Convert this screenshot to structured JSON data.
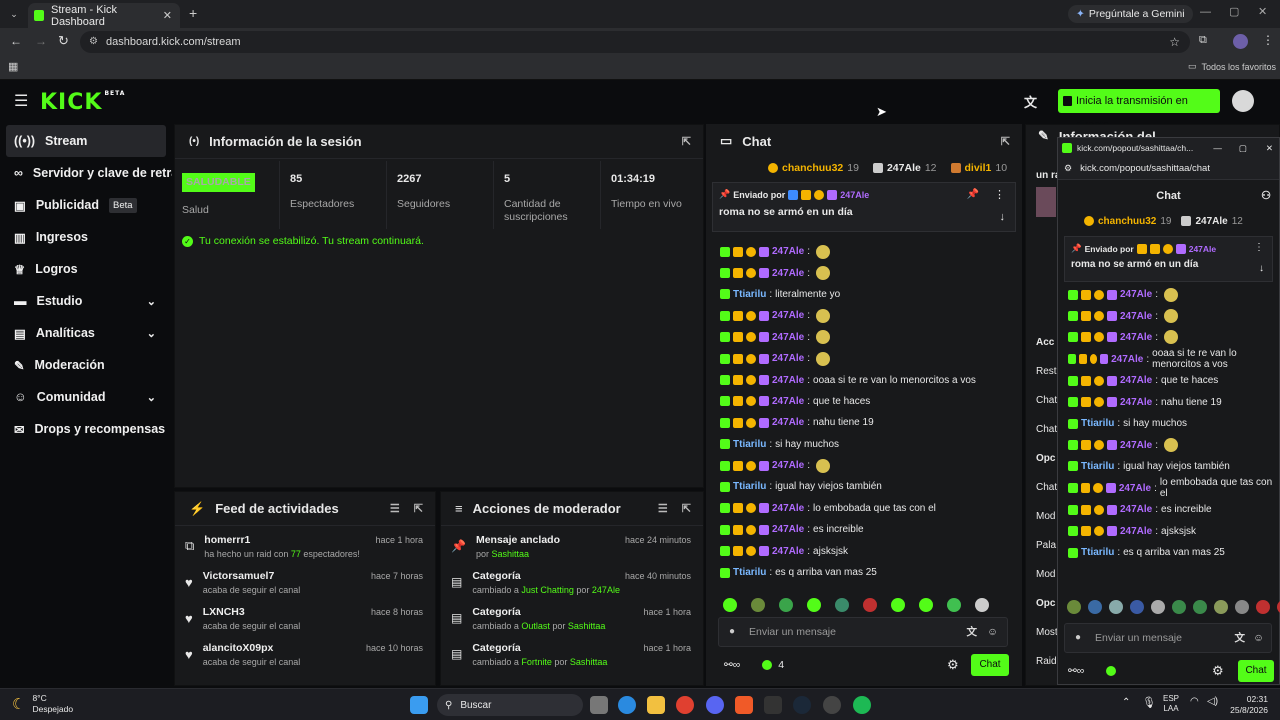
{
  "browser": {
    "tab_title": "Stream - Kick Dashboard",
    "url": "dashboard.kick.com/stream",
    "gemini_label": "Pregúntale a Gemini",
    "favorites_label": "Todos los favoritos"
  },
  "header": {
    "logo": "KICK",
    "logo_tag": "BETA",
    "go_live_label": "Inicia la transmisión en directo"
  },
  "sidebar": {
    "items": [
      {
        "label": "Stream",
        "icon": "broadcast-icon"
      },
      {
        "label": "Servidor y clave de retran",
        "icon": "link-icon"
      },
      {
        "label": "Publicidad",
        "badge": "Beta",
        "icon": "ad-icon"
      },
      {
        "label": "Ingresos",
        "icon": "chart-icon"
      },
      {
        "label": "Logros",
        "icon": "trophy-icon"
      },
      {
        "label": "Estudio",
        "icon": "studio-icon"
      },
      {
        "label": "Analíticas",
        "icon": "analytics-icon"
      },
      {
        "label": "Moderación",
        "icon": "wrench-icon"
      },
      {
        "label": "Comunidad",
        "icon": "community-icon"
      },
      {
        "label": "Drops y recompensas",
        "icon": "gift-icon"
      }
    ]
  },
  "session": {
    "title": "Información de la sesión",
    "health": "SALUDABLE",
    "health_label": "Salud",
    "viewers": "85",
    "viewers_label": "Espectadores",
    "followers": "2267",
    "followers_label": "Seguidores",
    "subs": "5",
    "subs_label": "Cantidad de suscripciones",
    "uptime": "01:34:19",
    "uptime_label": "Tiempo en vivo",
    "status_msg": "Tu conexión se estabilizó. Tu stream continuará."
  },
  "feed": {
    "title": "Feed de actividades",
    "items": [
      {
        "user": "homerrr1",
        "pre": "ha hecho un raid con ",
        "num": "77",
        "post": " espectadores!",
        "time": "hace 1 hora"
      },
      {
        "user": "Victorsamuel7",
        "pre": "acaba de seguir el canal",
        "num": "",
        "post": "",
        "time": "hace 7 horas"
      },
      {
        "user": "LXNCH3",
        "pre": "acaba de seguir el canal",
        "num": "",
        "post": "",
        "time": "hace 8 horas"
      },
      {
        "user": "alancitoX09px",
        "pre": "acaba de seguir el canal",
        "num": "",
        "post": "",
        "time": "hace 10 horas"
      }
    ]
  },
  "modactions": {
    "title": "Acciones de moderador",
    "items": [
      {
        "title": "Mensaje anclado",
        "pre": "por ",
        "hl": "Sashittaa",
        "mid": "",
        "hl2": "",
        "time": "hace 24 minutos"
      },
      {
        "title": "Categoría",
        "pre": "cambiado a ",
        "hl": "Just Chatting",
        "mid": " por ",
        "hl2": "247Ale",
        "time": "hace 40 minutos"
      },
      {
        "title": "Categoría",
        "pre": "cambiado a ",
        "hl": "Outlast",
        "mid": " por ",
        "hl2": "Sashittaa",
        "time": "hace 1 hora"
      },
      {
        "title": "Categoría",
        "pre": "cambiado a ",
        "hl": "Fortnite",
        "mid": " por ",
        "hl2": "Sashittaa",
        "time": "hace 1 hora"
      }
    ]
  },
  "chat": {
    "title": "Chat",
    "top": [
      {
        "user": "chanchuu32",
        "count": "19"
      },
      {
        "user": "247Ale",
        "count": "12"
      },
      {
        "user": "divil1",
        "count": "10"
      }
    ],
    "pinned_by_label": "Enviado por",
    "pinned_user": "247Ale",
    "pinned_text": "roma no se armó en un día",
    "messages": [
      {
        "user": "247Ale",
        "text": "",
        "emote": true,
        "sub": true
      },
      {
        "user": "247Ale",
        "text": "",
        "emote": true,
        "sub": true
      },
      {
        "user": "Ttiarilu",
        "text": "literalmente yo",
        "emote": false,
        "sub": false
      },
      {
        "user": "247Ale",
        "text": "",
        "emote": true,
        "sub": true
      },
      {
        "user": "247Ale",
        "text": "",
        "emote": true,
        "sub": true
      },
      {
        "user": "247Ale",
        "text": "",
        "emote": true,
        "sub": true
      },
      {
        "user": "247Ale",
        "text": "ooaa si te re van lo menorcitos a vos",
        "emote": false,
        "sub": true
      },
      {
        "user": "247Ale",
        "text": "que te haces",
        "emote": false,
        "sub": true
      },
      {
        "user": "247Ale",
        "text": "nahu tiene 19",
        "emote": false,
        "sub": true
      },
      {
        "user": "Ttiarilu",
        "text": "si hay muchos",
        "emote": false,
        "sub": false
      },
      {
        "user": "247Ale",
        "text": "",
        "emote": true,
        "sub": true
      },
      {
        "user": "Ttiarilu",
        "text": "igual hay viejos también",
        "emote": false,
        "sub": false
      },
      {
        "user": "247Ale",
        "text": "lo embobada que tas con el",
        "emote": false,
        "sub": true
      },
      {
        "user": "247Ale",
        "text": "es increible",
        "emote": false,
        "sub": true
      },
      {
        "user": "247Ale",
        "text": "ajsksjsk",
        "emote": false,
        "sub": true
      },
      {
        "user": "Ttiarilu",
        "text": "es q arriba van mas 25",
        "emote": false,
        "sub": false
      }
    ],
    "input_placeholder": "Enviar un mensaje",
    "viewers_count": "4",
    "send_label": "Chat"
  },
  "right_panel": {
    "title": "Información del",
    "snippet": "un ra",
    "labels": [
      "Acc",
      "Restr",
      "Chat",
      "Chat",
      "Opc",
      "Chat",
      "Mod",
      "Pala",
      "Mod",
      "Opc",
      "Most",
      "Raid"
    ]
  },
  "popout": {
    "url": "kick.com/popout/sashittaa/chat",
    "title_short": "kick.com/popout/sashittaa/ch...",
    "header": "Chat",
    "top": [
      {
        "user": "chanchuu32",
        "count": "19"
      },
      {
        "user": "247Ale",
        "count": "12"
      }
    ],
    "messages": [
      {
        "user": "247Ale",
        "text": "",
        "emote": true,
        "sub": true
      },
      {
        "user": "247Ale",
        "text": "",
        "emote": true,
        "sub": true
      },
      {
        "user": "247Ale",
        "text": "",
        "emote": true,
        "sub": true
      },
      {
        "user": "247Ale",
        "text": "ooaa si te re van lo menorcitos a vos",
        "emote": false,
        "sub": true
      },
      {
        "user": "247Ale",
        "text": "que te haces",
        "emote": false,
        "sub": true
      },
      {
        "user": "247Ale",
        "text": "nahu tiene 19",
        "emote": false,
        "sub": true
      },
      {
        "user": "Ttiarilu",
        "text": "si hay muchos",
        "emote": false,
        "sub": false
      },
      {
        "user": "247Ale",
        "text": "",
        "emote": true,
        "sub": true
      },
      {
        "user": "Ttiarilu",
        "text": "igual hay viejos también",
        "emote": false,
        "sub": false
      },
      {
        "user": "247Ale",
        "text": "lo embobada que tas con el",
        "emote": false,
        "sub": true
      },
      {
        "user": "247Ale",
        "text": "es increible",
        "emote": false,
        "sub": true
      },
      {
        "user": "247Ale",
        "text": "ajsksjsk",
        "emote": false,
        "sub": true
      },
      {
        "user": "Ttiarilu",
        "text": "es q arriba van mas 25",
        "emote": false,
        "sub": false
      }
    ],
    "input_placeholder": "Enviar un mensaje",
    "send_label": "Chat"
  },
  "taskbar": {
    "temp": "8°C",
    "weather": "Despejado",
    "search": "Buscar",
    "lang1": "ESP",
    "lang2": "LAA",
    "time": "02:31",
    "date": "25/8/2026"
  },
  "colors": {
    "accent": "#53fc18",
    "sub_user": "#b06bff",
    "bg": "#0b0c0e",
    "panel": "#18191b"
  }
}
